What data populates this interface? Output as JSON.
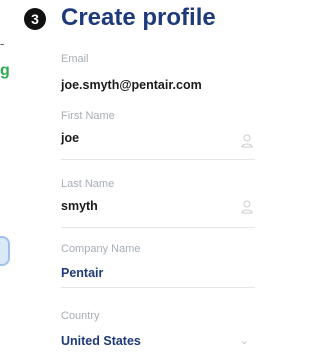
{
  "header": {
    "step_number": "3",
    "title": "Create profile"
  },
  "left_strip": {
    "partial_text": "g"
  },
  "form": {
    "email": {
      "label": "Email",
      "value": "joe.smyth@pentair.com"
    },
    "first_name": {
      "label": "First Name",
      "value": "joe",
      "icon": "person-icon"
    },
    "last_name": {
      "label": "Last Name",
      "value": "smyth",
      "icon": "person-icon"
    },
    "company_name": {
      "label": "Company Name",
      "value": "Pentair"
    },
    "country": {
      "label": "Country",
      "value": "United States",
      "icon": "chevron-down-icon"
    }
  },
  "colors": {
    "title": "#1f3a7a",
    "label": "#a7aeb6",
    "accent_green": "#2eaa4f"
  }
}
